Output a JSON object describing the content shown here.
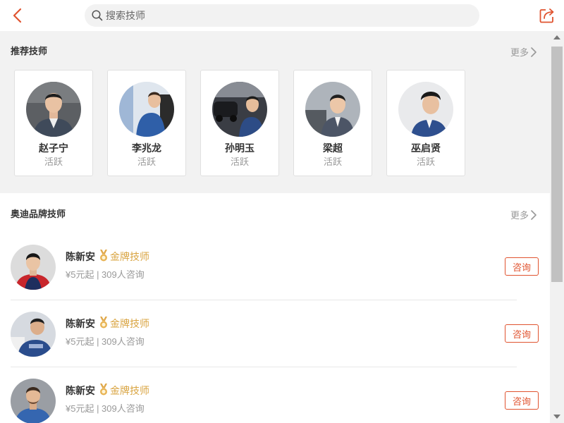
{
  "header": {
    "search_placeholder": "搜索技师"
  },
  "colors": {
    "accent": "#e0532f",
    "gold": "#d9a441",
    "section_bg": "#f2f2f2"
  },
  "recommended": {
    "title": "推荐技师",
    "more_label": "更多",
    "technicians": [
      {
        "name": "赵子宁",
        "status": "活跃"
      },
      {
        "name": "李兆龙",
        "status": "活跃"
      },
      {
        "name": "孙明玉",
        "status": "活跃"
      },
      {
        "name": "梁超",
        "status": "活跃"
      },
      {
        "name": "巫启贤",
        "status": "活跃"
      }
    ]
  },
  "brand": {
    "title": "奥迪品牌技师",
    "more_label": "更多",
    "technicians": [
      {
        "name": "陈新安",
        "badge": "金牌技师",
        "meta": "¥5元起 | 309人咨询",
        "button": "咨询"
      },
      {
        "name": "陈新安",
        "badge": "金牌技师",
        "meta": "¥5元起 | 309人咨询",
        "button": "咨询"
      },
      {
        "name": "陈新安",
        "badge": "金牌技师",
        "meta": "¥5元起 | 309人咨询",
        "button": "咨询"
      }
    ]
  }
}
